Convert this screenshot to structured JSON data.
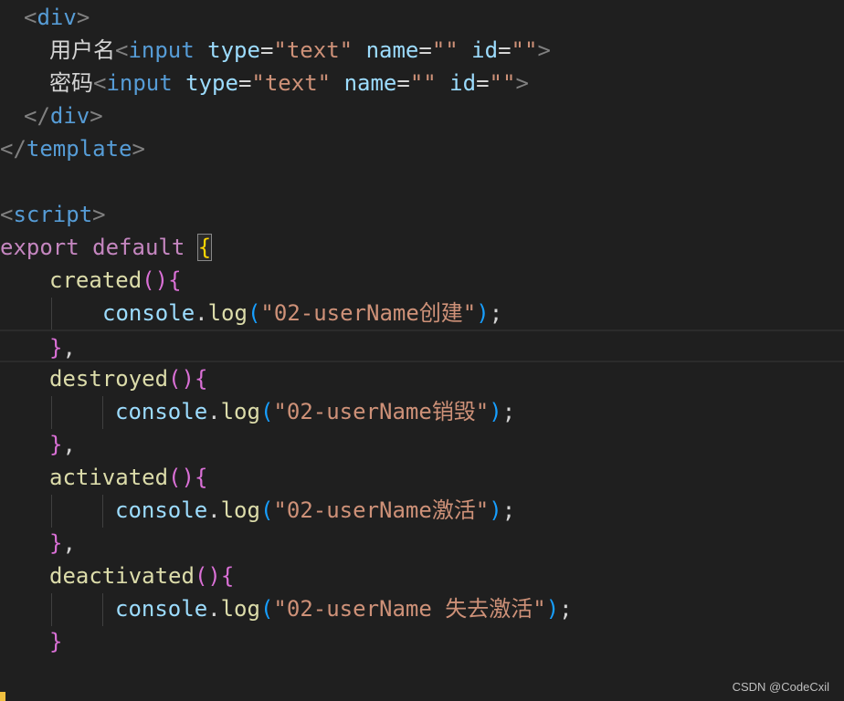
{
  "code": {
    "l1": {
      "open": "<",
      "tag": "div",
      "close": ">"
    },
    "l2": {
      "label": "用户名",
      "open": "<",
      "tag": "input",
      "a1": "type",
      "eq1": "=",
      "v1": "\"text\"",
      "a2": "name",
      "eq2": "=",
      "v2": "\"\"",
      "a3": "id",
      "eq3": "=",
      "v3": "\"\"",
      "close": ">"
    },
    "l3": {
      "label": "密码",
      "open": "<",
      "tag": "input",
      "a1": "type",
      "eq1": "=",
      "v1": "\"text\"",
      "a2": "name",
      "eq2": "=",
      "v2": "\"\"",
      "a3": "id",
      "eq3": "=",
      "v3": "\"\"",
      "close": ">"
    },
    "l4": {
      "open": "</",
      "tag": "div",
      "close": ">"
    },
    "l5": {
      "open": "</",
      "tag": "template",
      "close": ">"
    },
    "l7": {
      "open": "<",
      "tag": "script",
      "close": ">"
    },
    "l8": {
      "kw1": "export",
      "kw2": "default",
      "brace": "{"
    },
    "l9": {
      "fn": "created",
      "paren": "()",
      "brace": "{"
    },
    "l10": {
      "obj": "console",
      "dot": ".",
      "fn": "log",
      "po": "(",
      "str": "\"02-userName创建\"",
      "pc": ")",
      "semi": ";"
    },
    "l11": {
      "brace": "}",
      "comma": ","
    },
    "l12": {
      "fn": "destroyed",
      "paren": "()",
      "brace": "{"
    },
    "l13": {
      "obj": "console",
      "dot": ".",
      "fn": "log",
      "po": "(",
      "str": "\"02-userName销毁\"",
      "pc": ")",
      "semi": ";"
    },
    "l14": {
      "brace": "}",
      "comma": ","
    },
    "l15": {
      "fn": "activated",
      "paren": "()",
      "brace": "{"
    },
    "l16": {
      "obj": "console",
      "dot": ".",
      "fn": "log",
      "po": "(",
      "str": "\"02-userName激活\"",
      "pc": ")",
      "semi": ";"
    },
    "l17": {
      "brace": "}",
      "comma": ","
    },
    "l18": {
      "fn": "deactivated",
      "paren": "()",
      "brace": "{"
    },
    "l19": {
      "obj": "console",
      "dot": ".",
      "fn": "log",
      "po": "(",
      "str": "\"02-userName 失去激活\"",
      "pc": ")",
      "semi": ";"
    },
    "l20": {
      "brace": "}"
    }
  },
  "watermark": "CSDN @CodeCxil"
}
